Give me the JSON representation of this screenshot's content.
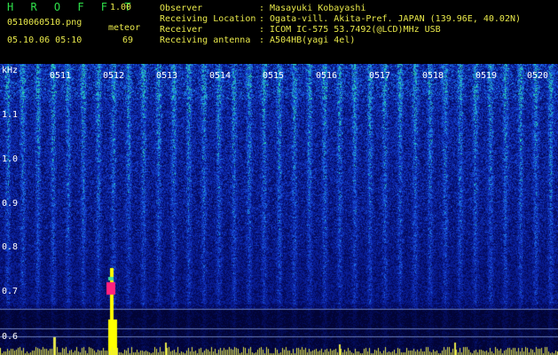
{
  "app": {
    "title": "H R O F F T",
    "version": "1.00"
  },
  "capture": {
    "file": "0510060510.png",
    "datetime": "05.10.06 05:10",
    "meteor_label": "meteor",
    "meteor_count": "69"
  },
  "info": [
    {
      "label": "Observer",
      "value": ": Masayuki Kobayashi"
    },
    {
      "label": "Receiving Location",
      "value": ": Ogata-vill. Akita-Pref. JAPAN (139.96E, 40.02N)"
    },
    {
      "label": "Receiver",
      "value": ": ICOM IC-575 53.7492(@LCD)MHz USB"
    },
    {
      "label": "Receiving antenna",
      "value": ": A504HB(yagi 4el)"
    }
  ],
  "axis": {
    "y_unit": "kHz",
    "y_ticks": [
      "1.1",
      "1.0",
      "0.9",
      "0.8",
      "0.7",
      "0.6"
    ],
    "x_ticks": [
      "0511",
      "0512",
      "0513",
      "0514",
      "0515",
      "0516",
      "0517",
      "0518",
      "0519",
      "0520"
    ]
  },
  "colors": {
    "background": "#000000",
    "spectrum_base": "#0a1a8c",
    "label_yellow": "#e8e84a",
    "title_green": "#2ee04a",
    "meteor_magenta": "#ff2080",
    "meteor_yellow": "#ffff00"
  }
}
